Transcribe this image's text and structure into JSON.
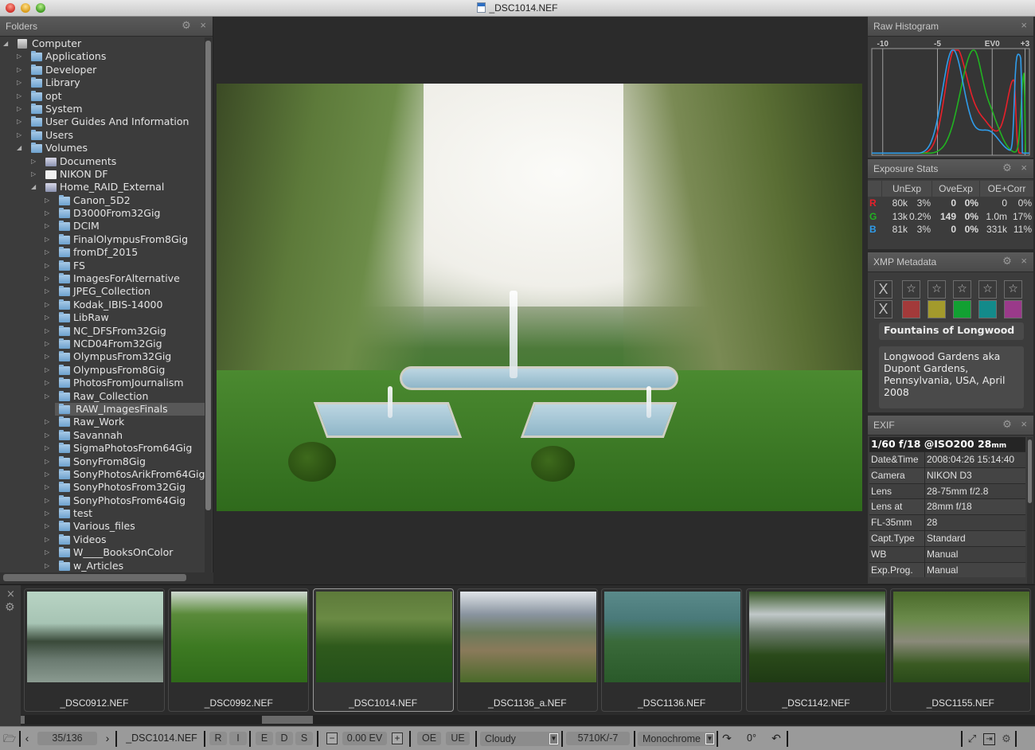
{
  "window": {
    "title": "_DSC1014.NEF"
  },
  "folders_panel": {
    "title": "Folders",
    "items": [
      {
        "label": "Computer",
        "depth": 0,
        "expanded": true,
        "icon": "computer"
      },
      {
        "label": "Applications",
        "depth": 1,
        "expanded": false,
        "icon": "folder"
      },
      {
        "label": "Developer",
        "depth": 1,
        "expanded": false,
        "icon": "folder"
      },
      {
        "label": "Library",
        "depth": 1,
        "expanded": false,
        "icon": "folder"
      },
      {
        "label": "opt",
        "depth": 1,
        "expanded": false,
        "icon": "folder"
      },
      {
        "label": "System",
        "depth": 1,
        "expanded": false,
        "icon": "folder"
      },
      {
        "label": "User Guides And Information",
        "depth": 1,
        "expanded": false,
        "icon": "folder"
      },
      {
        "label": "Users",
        "depth": 1,
        "expanded": false,
        "icon": "folder"
      },
      {
        "label": "Volumes",
        "depth": 1,
        "expanded": true,
        "icon": "folder"
      },
      {
        "label": "Documents",
        "depth": 2,
        "expanded": false,
        "icon": "drive"
      },
      {
        "label": "NIKON DF",
        "depth": 2,
        "expanded": false,
        "icon": "white"
      },
      {
        "label": "Home_RAID_External",
        "depth": 2,
        "expanded": true,
        "icon": "drive"
      },
      {
        "label": "Canon_5D2",
        "depth": 3,
        "expanded": false,
        "icon": "folder"
      },
      {
        "label": "D3000From32Gig",
        "depth": 3,
        "expanded": false,
        "icon": "folder"
      },
      {
        "label": "DCIM",
        "depth": 3,
        "expanded": false,
        "icon": "folder"
      },
      {
        "label": "FinalOlympusFrom8Gig",
        "depth": 3,
        "expanded": false,
        "icon": "folder"
      },
      {
        "label": "fromDf_2015",
        "depth": 3,
        "expanded": false,
        "icon": "folder"
      },
      {
        "label": "FS",
        "depth": 3,
        "expanded": false,
        "icon": "folder"
      },
      {
        "label": "ImagesForAlternative",
        "depth": 3,
        "expanded": false,
        "icon": "folder"
      },
      {
        "label": "JPEG_Collection",
        "depth": 3,
        "expanded": false,
        "icon": "folder"
      },
      {
        "label": "Kodak_IBIS-14000",
        "depth": 3,
        "expanded": false,
        "icon": "folder"
      },
      {
        "label": "LibRaw",
        "depth": 3,
        "expanded": false,
        "icon": "folder"
      },
      {
        "label": "NC_DFSFrom32Gig",
        "depth": 3,
        "expanded": false,
        "icon": "folder"
      },
      {
        "label": "NCD04From32Gig",
        "depth": 3,
        "expanded": false,
        "icon": "folder"
      },
      {
        "label": "OlympusFrom32Gig",
        "depth": 3,
        "expanded": false,
        "icon": "folder"
      },
      {
        "label": "OlympusFrom8Gig",
        "depth": 3,
        "expanded": false,
        "icon": "folder"
      },
      {
        "label": "PhotosFromJournalism",
        "depth": 3,
        "expanded": false,
        "icon": "folder"
      },
      {
        "label": "Raw_Collection",
        "depth": 3,
        "expanded": false,
        "icon": "folder"
      },
      {
        "label": "RAW_ImagesFinals",
        "depth": 3,
        "expanded": null,
        "icon": "folder",
        "selected": true
      },
      {
        "label": "Raw_Work",
        "depth": 3,
        "expanded": false,
        "icon": "folder"
      },
      {
        "label": "Savannah",
        "depth": 3,
        "expanded": false,
        "icon": "folder"
      },
      {
        "label": "SigmaPhotosFrom64Gig",
        "depth": 3,
        "expanded": false,
        "icon": "folder"
      },
      {
        "label": "SonyFrom8Gig",
        "depth": 3,
        "expanded": false,
        "icon": "folder"
      },
      {
        "label": "SonyPhotosArikFrom64Gig",
        "depth": 3,
        "expanded": false,
        "icon": "folder"
      },
      {
        "label": "SonyPhotosFrom32Gig",
        "depth": 3,
        "expanded": false,
        "icon": "folder"
      },
      {
        "label": "SonyPhotosFrom64Gig",
        "depth": 3,
        "expanded": false,
        "icon": "folder"
      },
      {
        "label": "test",
        "depth": 3,
        "expanded": false,
        "icon": "folder"
      },
      {
        "label": "Various_files",
        "depth": 3,
        "expanded": false,
        "icon": "folder"
      },
      {
        "label": "Videos",
        "depth": 3,
        "expanded": false,
        "icon": "folder"
      },
      {
        "label": "W____BooksOnColor",
        "depth": 3,
        "expanded": false,
        "icon": "folder"
      },
      {
        "label": "w_Articles",
        "depth": 3,
        "expanded": false,
        "icon": "folder"
      }
    ]
  },
  "histogram": {
    "title": "Raw Histogram",
    "ticks": [
      "-10",
      "-5",
      "EV0",
      "+3"
    ],
    "colors": {
      "r": "#e8202a",
      "g": "#21b321",
      "b": "#2f9cea"
    }
  },
  "exposure_stats": {
    "title": "Exposure Stats",
    "headers": [
      "UnExp",
      "OveExp",
      "OE+Corr"
    ],
    "rows": [
      {
        "ch": "R",
        "un_n": "80k",
        "un_p": "3%",
        "ov_n": "0",
        "ov_p": "0%",
        "oc_n": "0",
        "oc_p": "0%"
      },
      {
        "ch": "G",
        "un_n": "13k",
        "un_p": "0.2%",
        "ov_n": "149",
        "ov_p": "0%",
        "oc_n": "1.0m",
        "oc_p": "17%"
      },
      {
        "ch": "B",
        "un_n": "81k",
        "un_p": "3%",
        "ov_n": "0",
        "ov_p": "0%",
        "oc_n": "331k",
        "oc_p": "11%"
      }
    ]
  },
  "xmp": {
    "title": "XMP Metadata",
    "reject_label": "X",
    "star_glyph": "☆",
    "label_colors": [
      "#a33a3a",
      "#a39a2c",
      "#12a032",
      "#138a8a",
      "#9a3a8a"
    ],
    "title_value": "Fountains of Longwood",
    "description": "Longwood Gardens aka Dupont Gardens, Pennsylvania, USA, April 2008"
  },
  "exif": {
    "title": "EXIF",
    "summary": "1/60 f/18 @ISO200 28",
    "summary_unit": "mm",
    "rows": [
      {
        "k": "Date&Time",
        "v": "2008:04:26 15:14:40"
      },
      {
        "k": "Camera",
        "v": "NIKON D3"
      },
      {
        "k": "Lens",
        "v": "28-75mm f/2.8"
      },
      {
        "k": "Lens at",
        "v": "28mm f/18"
      },
      {
        "k": "FL-35mm",
        "v": "28"
      },
      {
        "k": "Capt.Type",
        "v": "Standard"
      },
      {
        "k": "WB",
        "v": "Manual"
      },
      {
        "k": "Exp.Prog.",
        "v": "Manual"
      }
    ]
  },
  "filmstrip": {
    "items": [
      {
        "name": "_DSC0912.NEF",
        "active": false
      },
      {
        "name": "_DSC0992.NEF",
        "active": false
      },
      {
        "name": "_DSC1014.NEF",
        "active": true
      },
      {
        "name": "_DSC1136_a.NEF",
        "active": false
      },
      {
        "name": "_DSC1136.NEF",
        "active": false
      },
      {
        "name": "_DSC1142.NEF",
        "active": false
      },
      {
        "name": "_DSC1155.NEF",
        "active": false
      }
    ]
  },
  "toolbar": {
    "counter": "35/136",
    "filename": "_DSC1014.NEF",
    "btn_r": "R",
    "btn_i": "I",
    "btn_e": "E",
    "btn_d": "D",
    "btn_s": "S",
    "ev_minus": "−",
    "ev_value": "0.00 EV",
    "ev_plus": "+",
    "btn_oe": "OE",
    "btn_ue": "UE",
    "wb_preset": "Cloudy",
    "wb_value": "5710K/-7",
    "profile": "Monochrome",
    "rotation": "0°"
  }
}
